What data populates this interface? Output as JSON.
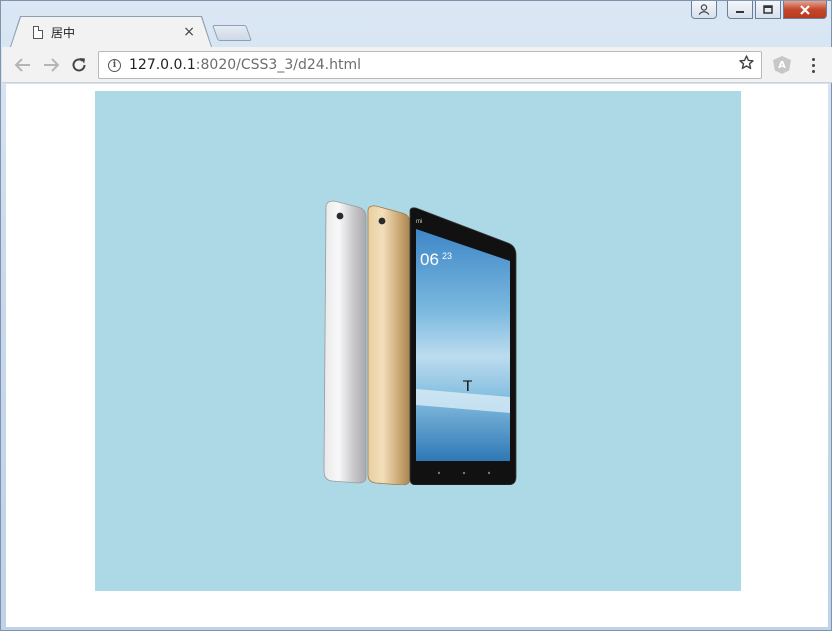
{
  "window": {
    "controls": {
      "user": "user-icon",
      "minimize": "minimize-icon",
      "maximize": "maximize-icon",
      "close": "close-icon"
    }
  },
  "tab": {
    "title": "居中",
    "close_glyph": "×"
  },
  "toolbar": {
    "back": "back-arrow-icon",
    "forward": "forward-arrow-icon",
    "reload": "reload-icon",
    "url_host": "127.0.0.1",
    "url_path": ":8020/CSS3_3/d24.html",
    "bookmark": "star-icon",
    "extension": "extension-icon",
    "menu": "menu-icon"
  },
  "page": {
    "box_color": "#add8e6",
    "image": "tablet-product-image"
  }
}
